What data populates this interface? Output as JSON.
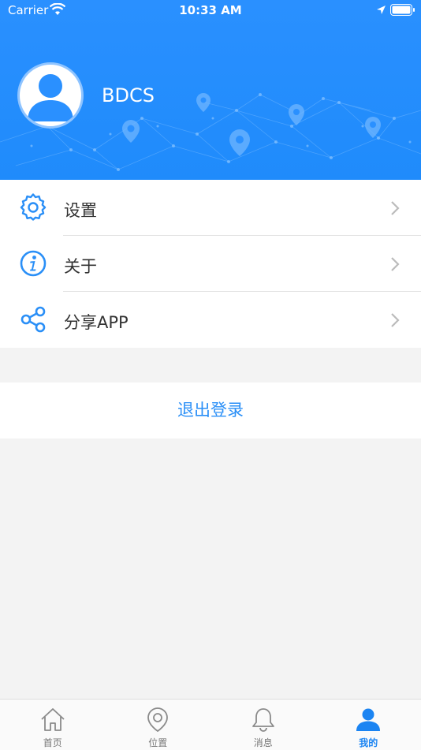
{
  "status_bar": {
    "carrier": "Carrier",
    "time": "10:33 AM"
  },
  "profile": {
    "username": "BDCS"
  },
  "menu": [
    {
      "label": "设置",
      "icon": "gear-icon"
    },
    {
      "label": "关于",
      "icon": "info-icon"
    },
    {
      "label": "分享APP",
      "icon": "share-icon"
    }
  ],
  "logout_label": "退出登录",
  "tabs": [
    {
      "label": "首页",
      "icon": "home-icon",
      "active": false
    },
    {
      "label": "位置",
      "icon": "location-pin-icon",
      "active": false
    },
    {
      "label": "消息",
      "icon": "bell-icon",
      "active": false
    },
    {
      "label": "我的",
      "icon": "user-icon",
      "active": true
    }
  ],
  "colors": {
    "accent": "#1f8bfb",
    "tab_active": "#1b84f2",
    "logout_text": "#2a8ff7"
  }
}
